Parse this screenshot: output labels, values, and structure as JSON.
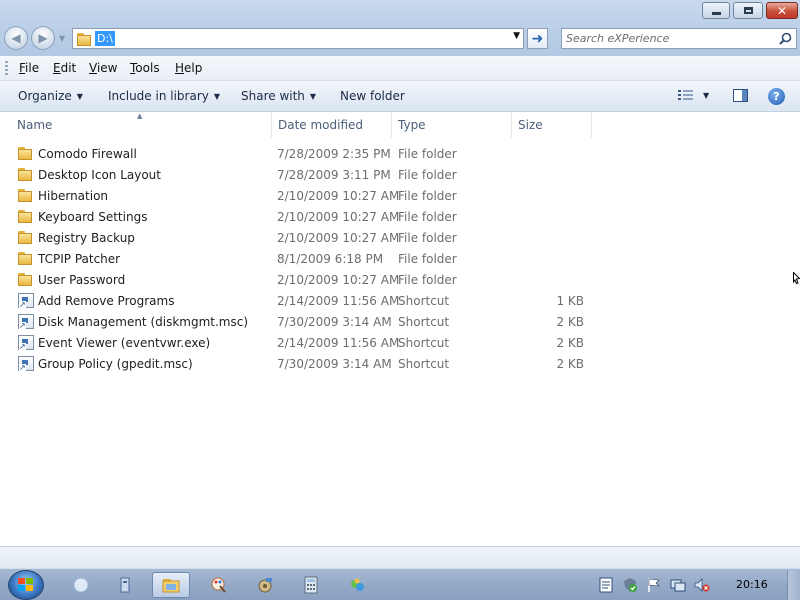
{
  "address": {
    "path": "D:\\"
  },
  "search": {
    "placeholder": "Search eXPerience"
  },
  "menu": [
    {
      "label": "File",
      "key": "F",
      "rest": "ile"
    },
    {
      "label": "Edit",
      "key": "E",
      "rest": "dit"
    },
    {
      "label": "View",
      "key": "V",
      "rest": "iew"
    },
    {
      "label": "Tools",
      "key": "T",
      "rest": "ools"
    },
    {
      "label": "Help",
      "key": "H",
      "rest": "elp"
    }
  ],
  "commands": {
    "organize": "Organize",
    "include_in_library": "Include in library",
    "share_with": "Share with",
    "new_folder": "New folder"
  },
  "columns": {
    "name": "Name",
    "date": "Date modified",
    "type": "Type",
    "size": "Size"
  },
  "files": [
    {
      "name": "Comodo Firewall",
      "date": "7/28/2009 2:35 PM",
      "type": "File folder",
      "size": "",
      "icon": "folder-icon"
    },
    {
      "name": "Desktop Icon Layout",
      "date": "7/28/2009 3:11 PM",
      "type": "File folder",
      "size": "",
      "icon": "folder-icon"
    },
    {
      "name": "Hibernation",
      "date": "2/10/2009 10:27 AM",
      "type": "File folder",
      "size": "",
      "icon": "folder-icon"
    },
    {
      "name": "Keyboard Settings",
      "date": "2/10/2009 10:27 AM",
      "type": "File folder",
      "size": "",
      "icon": "folder-icon"
    },
    {
      "name": "Registry Backup",
      "date": "2/10/2009 10:27 AM",
      "type": "File folder",
      "size": "",
      "icon": "folder-icon"
    },
    {
      "name": "TCPIP Patcher",
      "date": "8/1/2009 6:18 PM",
      "type": "File folder",
      "size": "",
      "icon": "folder-icon"
    },
    {
      "name": "User Password",
      "date": "2/10/2009 10:27 AM",
      "type": "File folder",
      "size": "",
      "icon": "folder-icon"
    },
    {
      "name": "Add Remove Programs",
      "date": "2/14/2009 11:56 AM",
      "type": "Shortcut",
      "size": "1 KB",
      "icon": "shortcut-icon"
    },
    {
      "name": "Disk Management (diskmgmt.msc)",
      "date": "7/30/2009 3:14 AM",
      "type": "Shortcut",
      "size": "2 KB",
      "icon": "shortcut-icon"
    },
    {
      "name": "Event Viewer (eventvwr.exe)",
      "date": "2/14/2009 11:56 AM",
      "type": "Shortcut",
      "size": "2 KB",
      "icon": "shortcut-icon"
    },
    {
      "name": "Group Policy (gpedit.msc)",
      "date": "7/30/2009 3:14 AM",
      "type": "Shortcut",
      "size": "2 KB",
      "icon": "shortcut-icon"
    }
  ],
  "taskbar": {
    "clock": "20:16",
    "pinned_icons": [
      "ie-icon",
      "library-icon",
      "explorer-icon",
      "paint-icon",
      "settings-icon",
      "calculator-icon",
      "messenger-icon"
    ],
    "tray_icons": [
      "notes-icon",
      "security-icon",
      "action-center-flag-icon",
      "network-icon",
      "volume-muted-icon"
    ]
  },
  "colors": {
    "titlebar": "#bcd0e8",
    "selection": "#3399ff",
    "taskbar": "#94aac8"
  }
}
